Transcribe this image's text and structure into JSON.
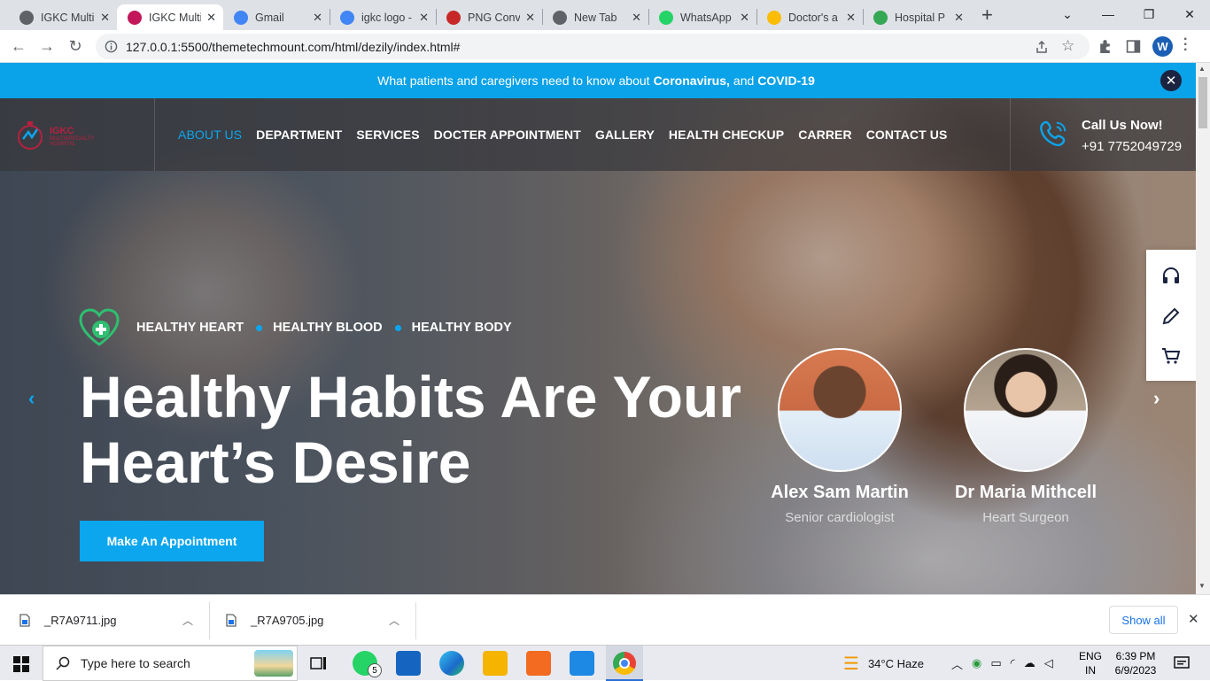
{
  "browser": {
    "tabs": [
      {
        "title": "IGKC Multi",
        "color": "#5f6368"
      },
      {
        "title": "IGKC Multi",
        "color": "#c2185b"
      },
      {
        "title": "Gmail",
        "color": "#4285f4"
      },
      {
        "title": "igkc logo -",
        "color": "#4285f4"
      },
      {
        "title": "PNG Conv",
        "color": "#c62828"
      },
      {
        "title": "New Tab",
        "color": "#5f6368"
      },
      {
        "title": "WhatsApp",
        "color": "#25d366"
      },
      {
        "title": "Doctor's a",
        "color": "#fbbc04"
      },
      {
        "title": "Hospital P",
        "color": "#34a853"
      }
    ],
    "new_tab_label": "+",
    "url": "127.0.0.1:5500/themetechmount.com/html/dezily/index.html#",
    "profile_initial": "W"
  },
  "site": {
    "notice": {
      "prefix": "What patients and caregivers need to know about",
      "highlight1": "Coronavirus,",
      "mid": "and",
      "highlight2": "COVID-19",
      "close": "✕"
    },
    "logo": {
      "title": "IGKC",
      "subtitle": "MULTISPECIALTY HOSPITAL"
    },
    "menu": [
      "ABOUT US",
      "DEPARTMENT",
      "SERVICES",
      "DOCTER APPOINTMENT",
      "GALLERY",
      "HEALTH CHECKUP",
      "CARRER",
      "CONTACT US"
    ],
    "call": {
      "title": "Call Us Now!",
      "number": "+91 7752049729"
    },
    "hero": {
      "tags": [
        "HEALTHY HEART",
        "HEALTHY BLOOD",
        "HEALTHY BODY"
      ],
      "headline_1": "Healthy Habits Are Your",
      "headline_2": "Heart’s Desire",
      "button": "Make An Appointment",
      "prev": "‹",
      "next": "›"
    },
    "doctors": [
      {
        "name": "Alex Sam Martin",
        "role": "Senior cardiologist"
      },
      {
        "name": "Dr Maria Mithcell",
        "role": "Heart Surgeon"
      }
    ],
    "side_icons": [
      "headphones-icon",
      "pencil-icon",
      "cart-icon"
    ]
  },
  "downloads": {
    "items": [
      "_R7A9711.jpg",
      "_R7A9705.jpg"
    ],
    "show_all": "Show all"
  },
  "taskbar": {
    "search_placeholder": "Type here to search",
    "whatsapp_badge": "5",
    "weather": "34°C  Haze",
    "lang_1": "ENG",
    "lang_2": "IN",
    "time": "6:39 PM",
    "date": "6/9/2023"
  }
}
